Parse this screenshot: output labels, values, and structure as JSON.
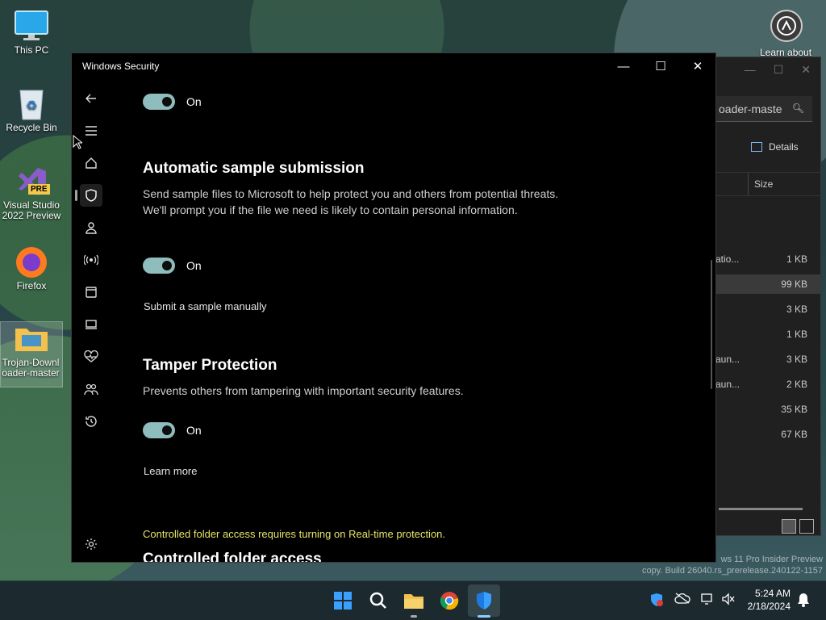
{
  "desktop": {
    "icons": [
      {
        "label": "This PC"
      },
      {
        "label": "Recycle Bin"
      },
      {
        "label": "Visual Studio 2022 Preview",
        "badge": "PRE"
      },
      {
        "label": "Firefox"
      },
      {
        "label": "Trojan-Downloader-master"
      }
    ],
    "learn_about": "Learn about",
    "watermark_line1": "ws 11 Pro Insider Preview",
    "watermark_line2": "copy. Build 26040.rs_prerelease.240122-1157"
  },
  "explorer": {
    "search_text": "oader-maste",
    "details_label": "Details",
    "column_size": "Size",
    "rows": [
      {
        "name": "atio...",
        "size": "1 KB",
        "selected": false
      },
      {
        "name": "",
        "size": "99 KB",
        "selected": true
      },
      {
        "name": "",
        "size": "3 KB",
        "selected": false
      },
      {
        "name": "",
        "size": "1 KB",
        "selected": false
      },
      {
        "name": "aun...",
        "size": "3 KB",
        "selected": false
      },
      {
        "name": "aun...",
        "size": "2 KB",
        "selected": false
      },
      {
        "name": "",
        "size": "35 KB",
        "selected": false
      },
      {
        "name": "",
        "size": "67 KB",
        "selected": false
      }
    ]
  },
  "window": {
    "title": "Windows Security"
  },
  "content": {
    "toggle1_state": "On",
    "auto_sample": {
      "heading": "Automatic sample submission",
      "description": "Send sample files to Microsoft to help protect you and others from potential threats. We'll prompt you if the file we need is likely to contain personal information.",
      "state": "On",
      "link": "Submit a sample manually"
    },
    "tamper": {
      "heading": "Tamper Protection",
      "description": "Prevents others from tampering with important security features.",
      "state": "On",
      "link": "Learn more"
    },
    "cfa_warning": "Controlled folder access requires turning on Real-time protection.",
    "cfa_heading": "Controlled folder access"
  },
  "taskbar": {
    "time": "5:24 AM",
    "date": "2/18/2024"
  },
  "colors": {
    "toggle_on": "#8fbcbc",
    "warning": "#e6e36a",
    "window_bg": "#000000"
  }
}
